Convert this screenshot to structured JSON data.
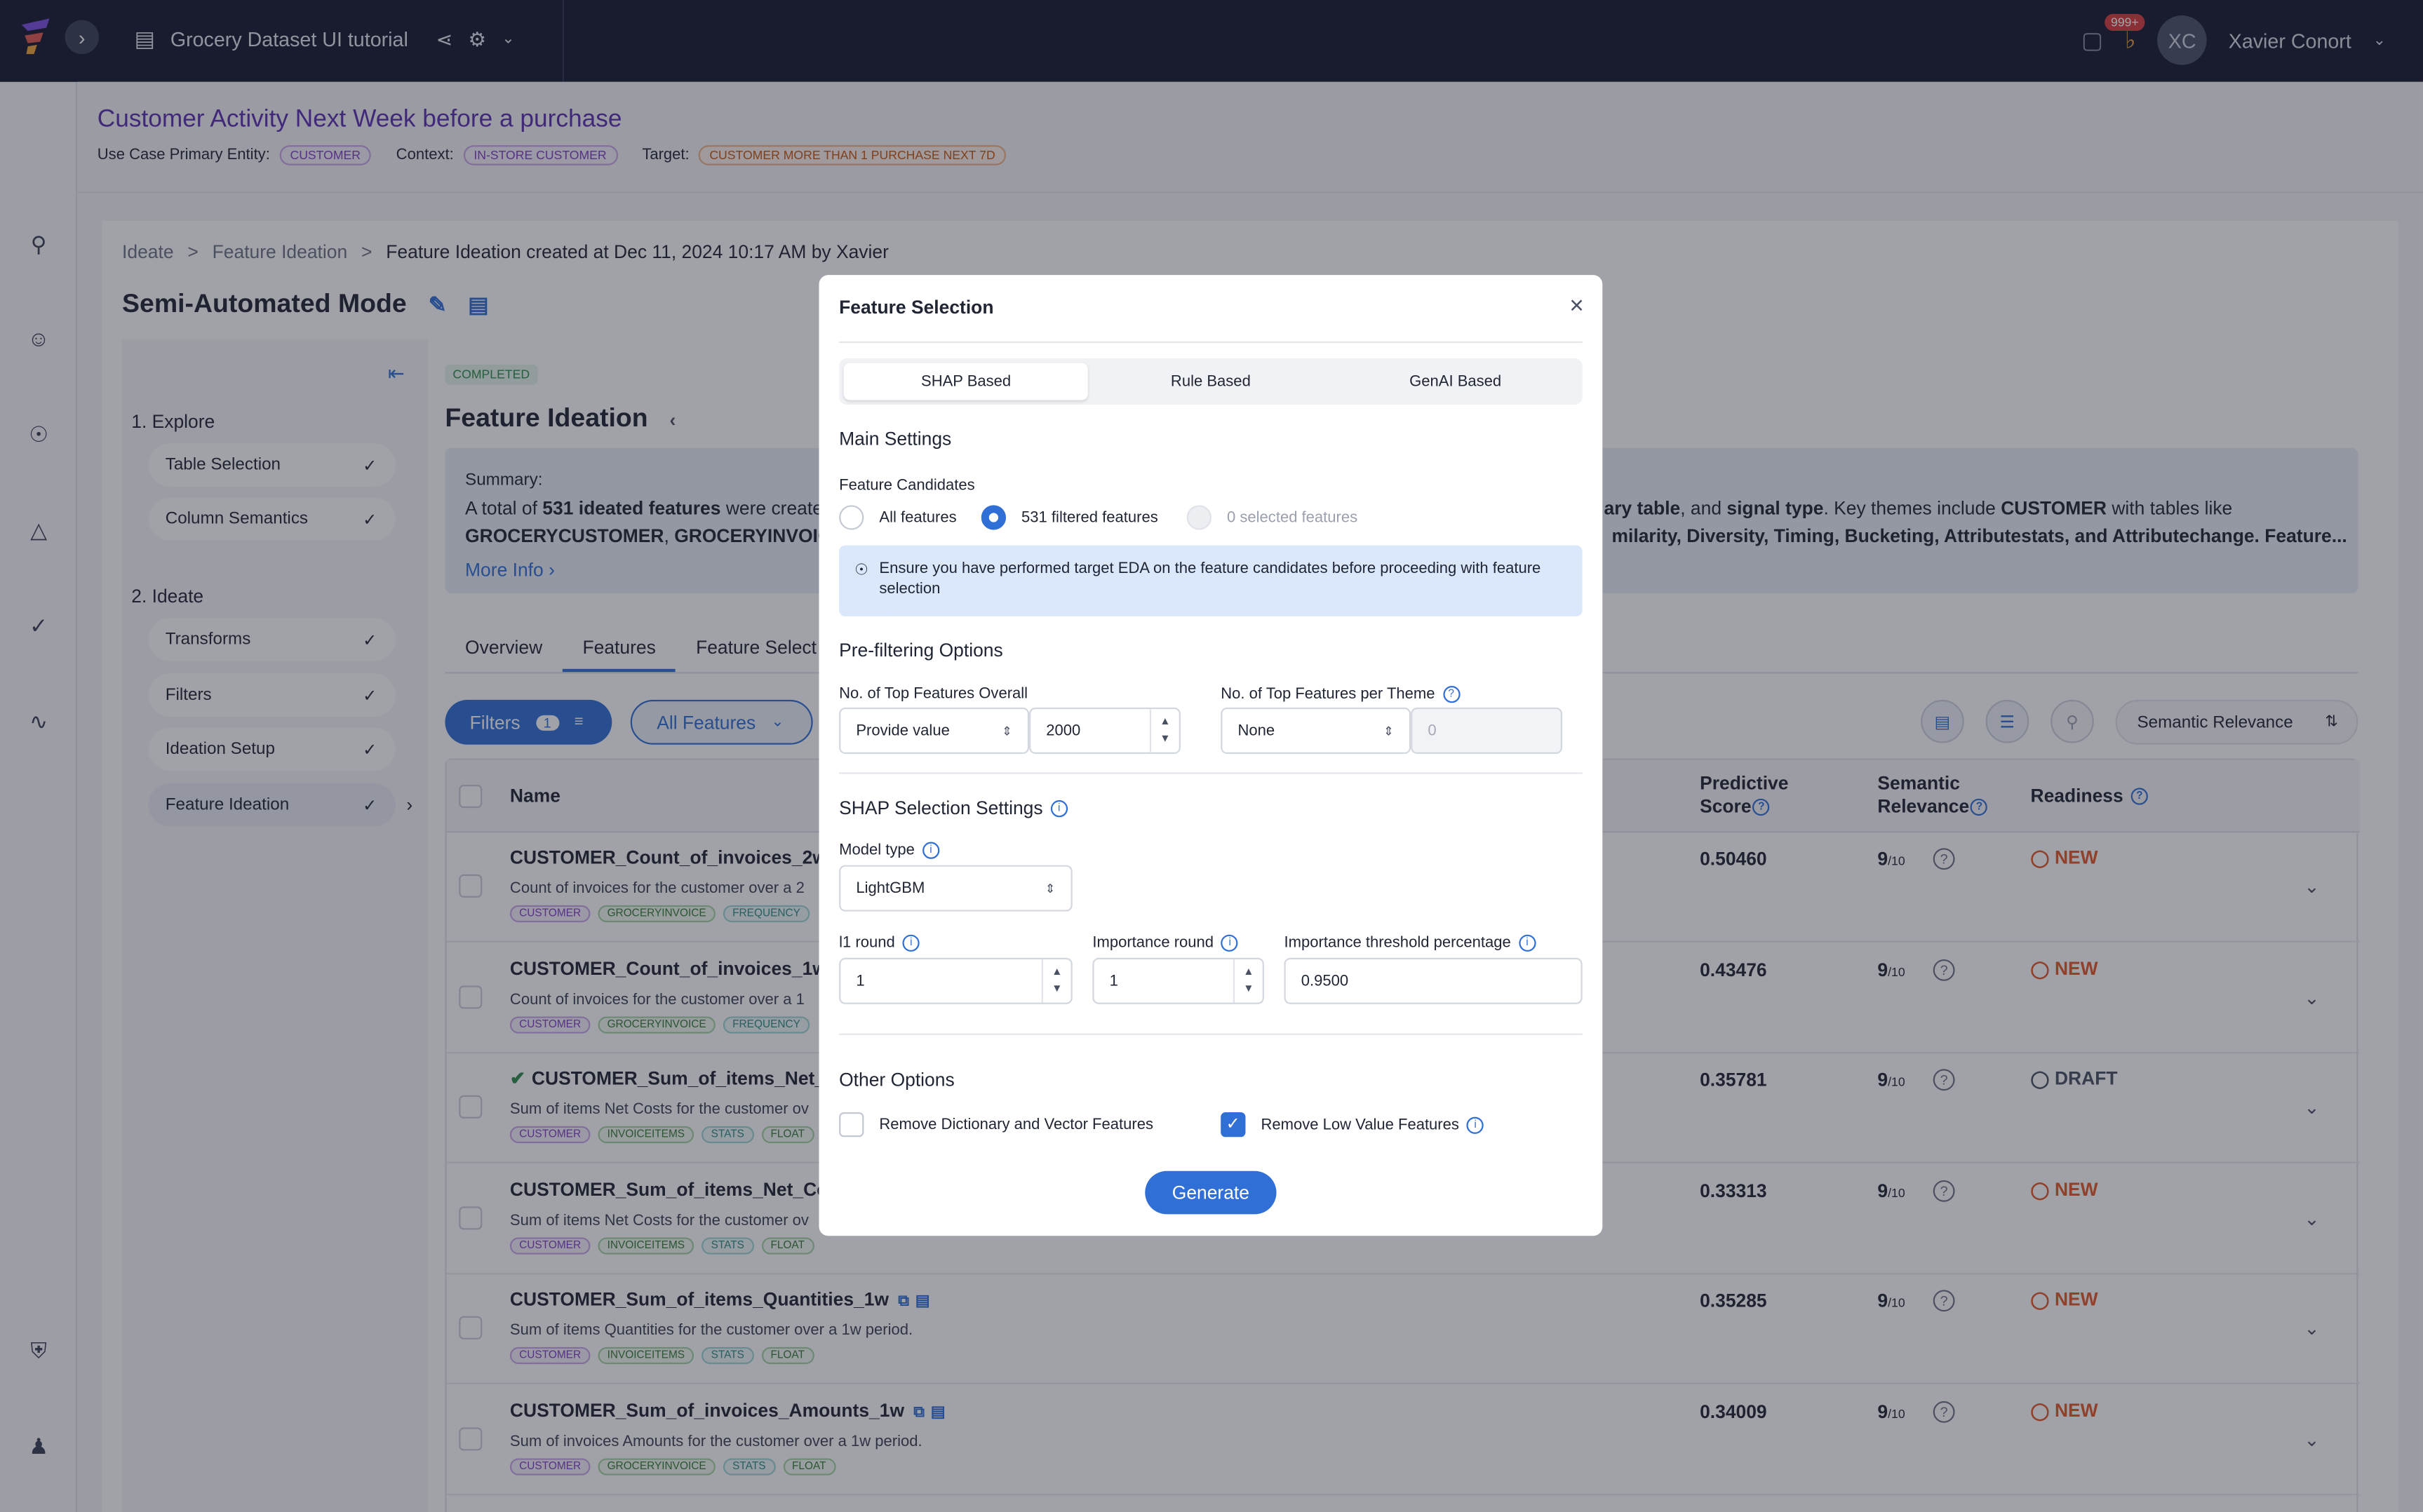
{
  "app": {
    "project_name": "Grocery Dataset UI tutorial",
    "user_name": "Xavier Conort",
    "user_initials": "XC",
    "notification_count": "999+"
  },
  "use_case": {
    "title": "Customer Activity Next Week before a purchase",
    "primary_entity_label": "Use Case Primary Entity:",
    "primary_entity": "CUSTOMER",
    "context_label": "Context:",
    "context": "IN-STORE CUSTOMER",
    "target_label": "Target:",
    "target": "CUSTOMER MORE THAN 1 PURCHASE NEXT 7D"
  },
  "breadcrumb": {
    "items": [
      "Ideate",
      ">",
      "Feature Ideation",
      ">"
    ],
    "current": "Feature Ideation created at Dec 11, 2024 10:17 AM by Xavier"
  },
  "mode_title": "Semi-Automated Mode",
  "steps": {
    "explore": "1. Explore",
    "explore_items": [
      "Table Selection",
      "Column Semantics"
    ],
    "ideate": "2. Ideate",
    "ideate_items": [
      "Transforms",
      "Filters",
      "Ideation Setup",
      "Feature Ideation"
    ]
  },
  "panel": {
    "status": "COMPLETED",
    "title": "Feature Ideation",
    "summary_label": "Summary:",
    "summary_line1_a": "A total of ",
    "summary_line1_b": "531 ideated features",
    "summary_line1_c": " were create",
    "summary_line1_right_a": "ary table",
    "summary_line1_right_b": ", and ",
    "summary_line1_right_c": "signal type",
    "summary_line1_right_d": ". Key themes include ",
    "summary_line1_right_e": "CUSTOMER",
    "summary_line1_right_f": " with tables like",
    "summary_line2_a": "GROCERYCUSTOMER",
    "summary_line2_b": ", ",
    "summary_line2_c": "GROCERYINVOICE",
    "summary_line2_right": "milarity, Diversity, Timing, Bucketing, Attributestats, and Attributechange. Feature...",
    "more_info": "More Info"
  },
  "tabs": [
    "Overview",
    "Features",
    "Feature Select"
  ],
  "toolbar": {
    "filters": "Filters",
    "filters_count": "1",
    "all_features": "All Features",
    "sort": "Semantic Relevance"
  },
  "table": {
    "headers": {
      "name": "Name",
      "predictive": "Predictive",
      "predictive2": "Score",
      "semantic": "Semantic",
      "semantic2": "Relevance",
      "readiness": "Readiness"
    },
    "rows": [
      {
        "name": "CUSTOMER_Count_of_invoices_2w",
        "desc": "Count of invoices for the customer over a 2",
        "tags": [
          "CUSTOMER",
          "GROCERYINVOICE",
          "FREQUENCY"
        ],
        "score": "0.50460",
        "sem": "9",
        "sem_den": "/10",
        "ready": "NEW"
      },
      {
        "name": "CUSTOMER_Count_of_invoices_1w",
        "desc": "Count of invoices for the customer over a 1",
        "tags": [
          "CUSTOMER",
          "GROCERYINVOICE",
          "FREQUENCY"
        ],
        "score": "0.43476",
        "sem": "9",
        "sem_den": "/10",
        "ready": "NEW"
      },
      {
        "name": "CUSTOMER_Sum_of_items_Net_C",
        "desc": "Sum of items Net Costs for the customer ov",
        "tags": [
          "CUSTOMER",
          "INVOICEITEMS",
          "STATS",
          "FLOAT"
        ],
        "score": "0.35781",
        "sem": "9",
        "sem_den": "/10",
        "ready": "DRAFT"
      },
      {
        "name": "CUSTOMER_Sum_of_items_Net_Cost",
        "desc": "Sum of items Net Costs for the customer ov",
        "tags": [
          "CUSTOMER",
          "INVOICEITEMS",
          "STATS",
          "FLOAT"
        ],
        "score": "0.33313",
        "sem": "9",
        "sem_den": "/10",
        "ready": "NEW"
      },
      {
        "name": "CUSTOMER_Sum_of_items_Quantities_1w",
        "desc": "Sum of items Quantities for the customer over a 1w period.",
        "tags": [
          "CUSTOMER",
          "INVOICEITEMS",
          "STATS",
          "FLOAT"
        ],
        "score": "0.35285",
        "sem": "9",
        "sem_den": "/10",
        "ready": "NEW"
      },
      {
        "name": "CUSTOMER_Sum_of_invoices_Amounts_1w",
        "desc": "Sum of invoices Amounts for the customer over a 1w period.",
        "tags": [
          "CUSTOMER",
          "GROCERYINVOICE",
          "STATS",
          "FLOAT"
        ],
        "score": "0.34009",
        "sem": "9",
        "sem_den": "/10",
        "ready": "NEW"
      }
    ]
  },
  "modal": {
    "title": "Feature Selection",
    "tabs": [
      "SHAP Based",
      "Rule Based",
      "GenAI Based"
    ],
    "main_settings": "Main Settings",
    "candidates_label": "Feature Candidates",
    "candidates": [
      "All features",
      "531 filtered features",
      "0 selected features"
    ],
    "info": "Ensure you have performed target EDA on the feature candidates before proceeding with feature selection",
    "prefilter": "Pre-filtering Options",
    "top_overall_label": "No. of Top Features Overall",
    "top_overall_mode": "Provide value",
    "top_overall_value": "2000",
    "top_theme_label": "No. of Top Features per Theme",
    "top_theme_mode": "None",
    "top_theme_value": "0",
    "shap_settings": "SHAP Selection Settings",
    "model_type_label": "Model type",
    "model_type": "LightGBM",
    "l1_label": "l1 round",
    "l1_value": "1",
    "imp_round_label": "Importance round",
    "imp_round_value": "1",
    "imp_thr_label": "Importance threshold percentage",
    "imp_thr_value": "0.9500",
    "other": "Other Options",
    "opt1": "Remove Dictionary and Vector Features",
    "opt2": "Remove Low Value Features",
    "generate": "Generate"
  },
  "colors": {
    "topbar": "#15192e",
    "accent": "#2f6fd6",
    "usecase_title": "#5b2fb0",
    "new": "#e0592a"
  }
}
